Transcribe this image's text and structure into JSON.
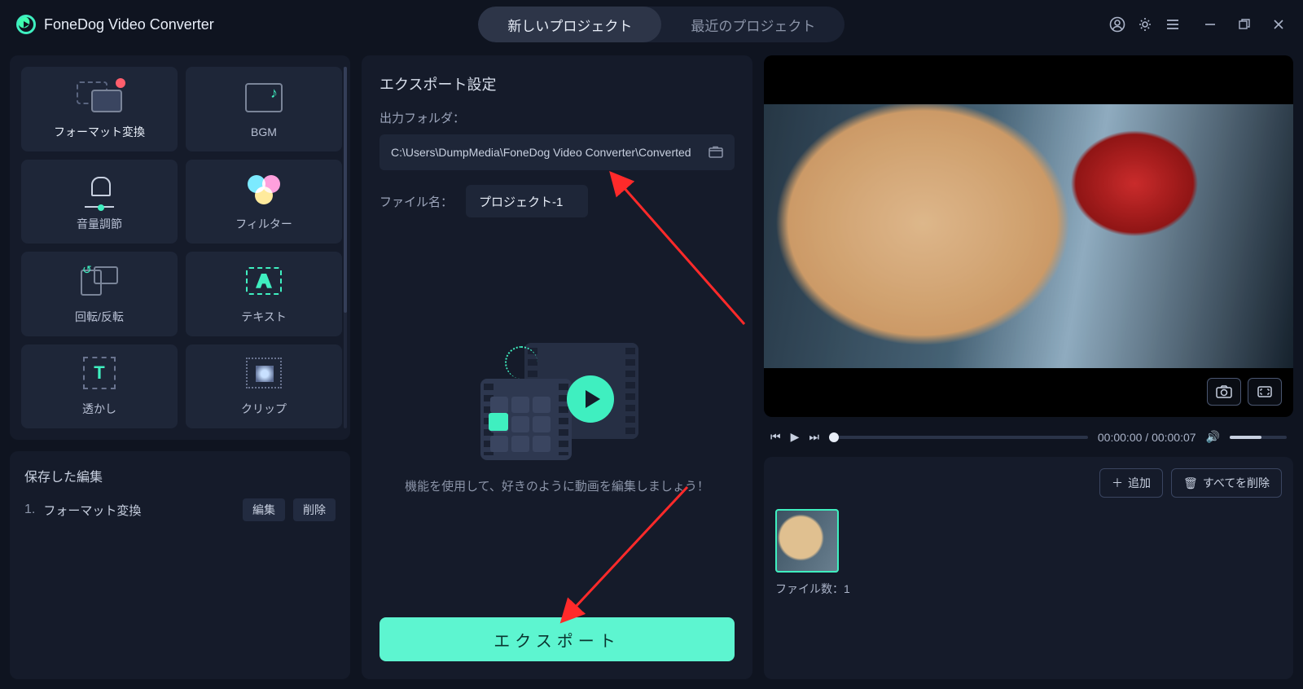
{
  "app": {
    "title": "FoneDog Video Converter"
  },
  "tabs": {
    "new_project": "新しいプロジェクト",
    "recent_project": "最近のプロジェクト"
  },
  "tools": {
    "items": [
      {
        "label": "フォーマット変換"
      },
      {
        "label": "BGM"
      },
      {
        "label": "音量調節"
      },
      {
        "label": "フィルター"
      },
      {
        "label": "回転/反転"
      },
      {
        "label": "テキスト"
      },
      {
        "label": "透かし"
      },
      {
        "label": "クリップ"
      }
    ]
  },
  "saved": {
    "title": "保存した編集",
    "entries": [
      {
        "num": "1.",
        "name": "フォーマット変換"
      }
    ],
    "edit_btn": "編集",
    "delete_btn": "削除"
  },
  "export": {
    "settings_title": "エクスポート設定",
    "output_folder_label": "出力フォルダ：",
    "output_folder_path": "C:\\Users\\DumpMedia\\FoneDog Video Converter\\Converted",
    "filename_label": "ファイル名：",
    "filename_value": "プロジェクト-1",
    "hint": "機能を使用して、好きのように動画を編集しましょう！",
    "export_btn": "エクスポート"
  },
  "player": {
    "time_current": "00:00:00",
    "time_sep": " / ",
    "time_total": "00:00:07"
  },
  "clips": {
    "add_btn": "追加",
    "clear_btn": "すべてを削除",
    "count_label": "ファイル数：",
    "count_value": "1"
  },
  "colors": {
    "accent": "#3fefc0",
    "bg": "#0f1420",
    "panel": "#151b2a"
  }
}
